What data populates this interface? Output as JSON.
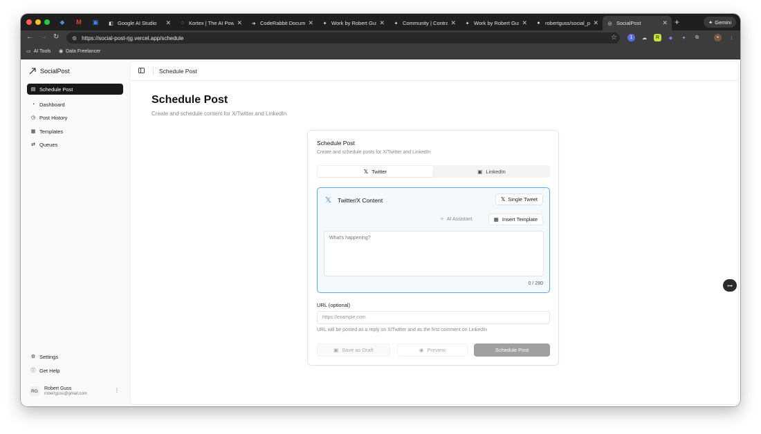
{
  "browser": {
    "tabs": [
      {
        "title": "Google AI Studio"
      },
      {
        "title": "Kortex | The AI Powe"
      },
      {
        "title": "CodeRabbit Docume"
      },
      {
        "title": "Work by Robert Gus"
      },
      {
        "title": "Community | Contra"
      },
      {
        "title": "Work by Robert Gus"
      },
      {
        "title": "robertguss/social_p"
      },
      {
        "title": "SocialPost"
      }
    ],
    "new_tab": "+",
    "gemini_label": "Gemini",
    "url": "https://social-post-rjg.vercel.app/schedule",
    "bookmarks": [
      {
        "label": "AI Tools"
      },
      {
        "label": "Data Freelancer"
      }
    ]
  },
  "sidebar": {
    "brand": "SocialPost",
    "items": [
      {
        "label": "Schedule Post",
        "icon": "calendar-icon",
        "active": true
      },
      {
        "label": "Dashboard",
        "icon": "gauge-icon"
      },
      {
        "label": "Post History",
        "icon": "clock-icon"
      },
      {
        "label": "Templates",
        "icon": "grid-icon"
      },
      {
        "label": "Queues",
        "icon": "repeat-icon"
      }
    ],
    "footer_items": [
      {
        "label": "Settings",
        "icon": "gear-icon"
      },
      {
        "label": "Get Help",
        "icon": "help-icon"
      }
    ],
    "user": {
      "initials": "RG",
      "name": "Robert Guss",
      "email": "robertguss@gmail.com"
    }
  },
  "header": {
    "breadcrumb": "Schedule Post"
  },
  "page": {
    "title": "Schedule Post",
    "subtitle": "Create and schedule content for X/Twitter and LinkedIn"
  },
  "card": {
    "title": "Schedule Post",
    "subtitle": "Create and schedule posts for X/Twitter and LinkedIn",
    "tabs": [
      {
        "label": "Twitter",
        "selected": true
      },
      {
        "label": "LinkedIn",
        "selected": false
      }
    ],
    "editor": {
      "title": "Twitter/X Content",
      "mode_button": "Single Tweet",
      "ai_assistant": "AI Assistant",
      "insert_template": "Insert Template",
      "placeholder": "What's happening?",
      "char_count": "0 / 280"
    },
    "url": {
      "label": "URL (optional)",
      "placeholder": "https://example.com",
      "help": "URL will be posted as a reply on X/Twitter and as the first comment on LinkedIn"
    },
    "actions": {
      "save_draft": "Save as Draft",
      "preview": "Preview",
      "schedule": "Schedule Post"
    }
  },
  "colors": {
    "accent_blue": "#5aa9e6",
    "active_nav": "#18181b",
    "disabled_button": "#a0a0a0"
  }
}
